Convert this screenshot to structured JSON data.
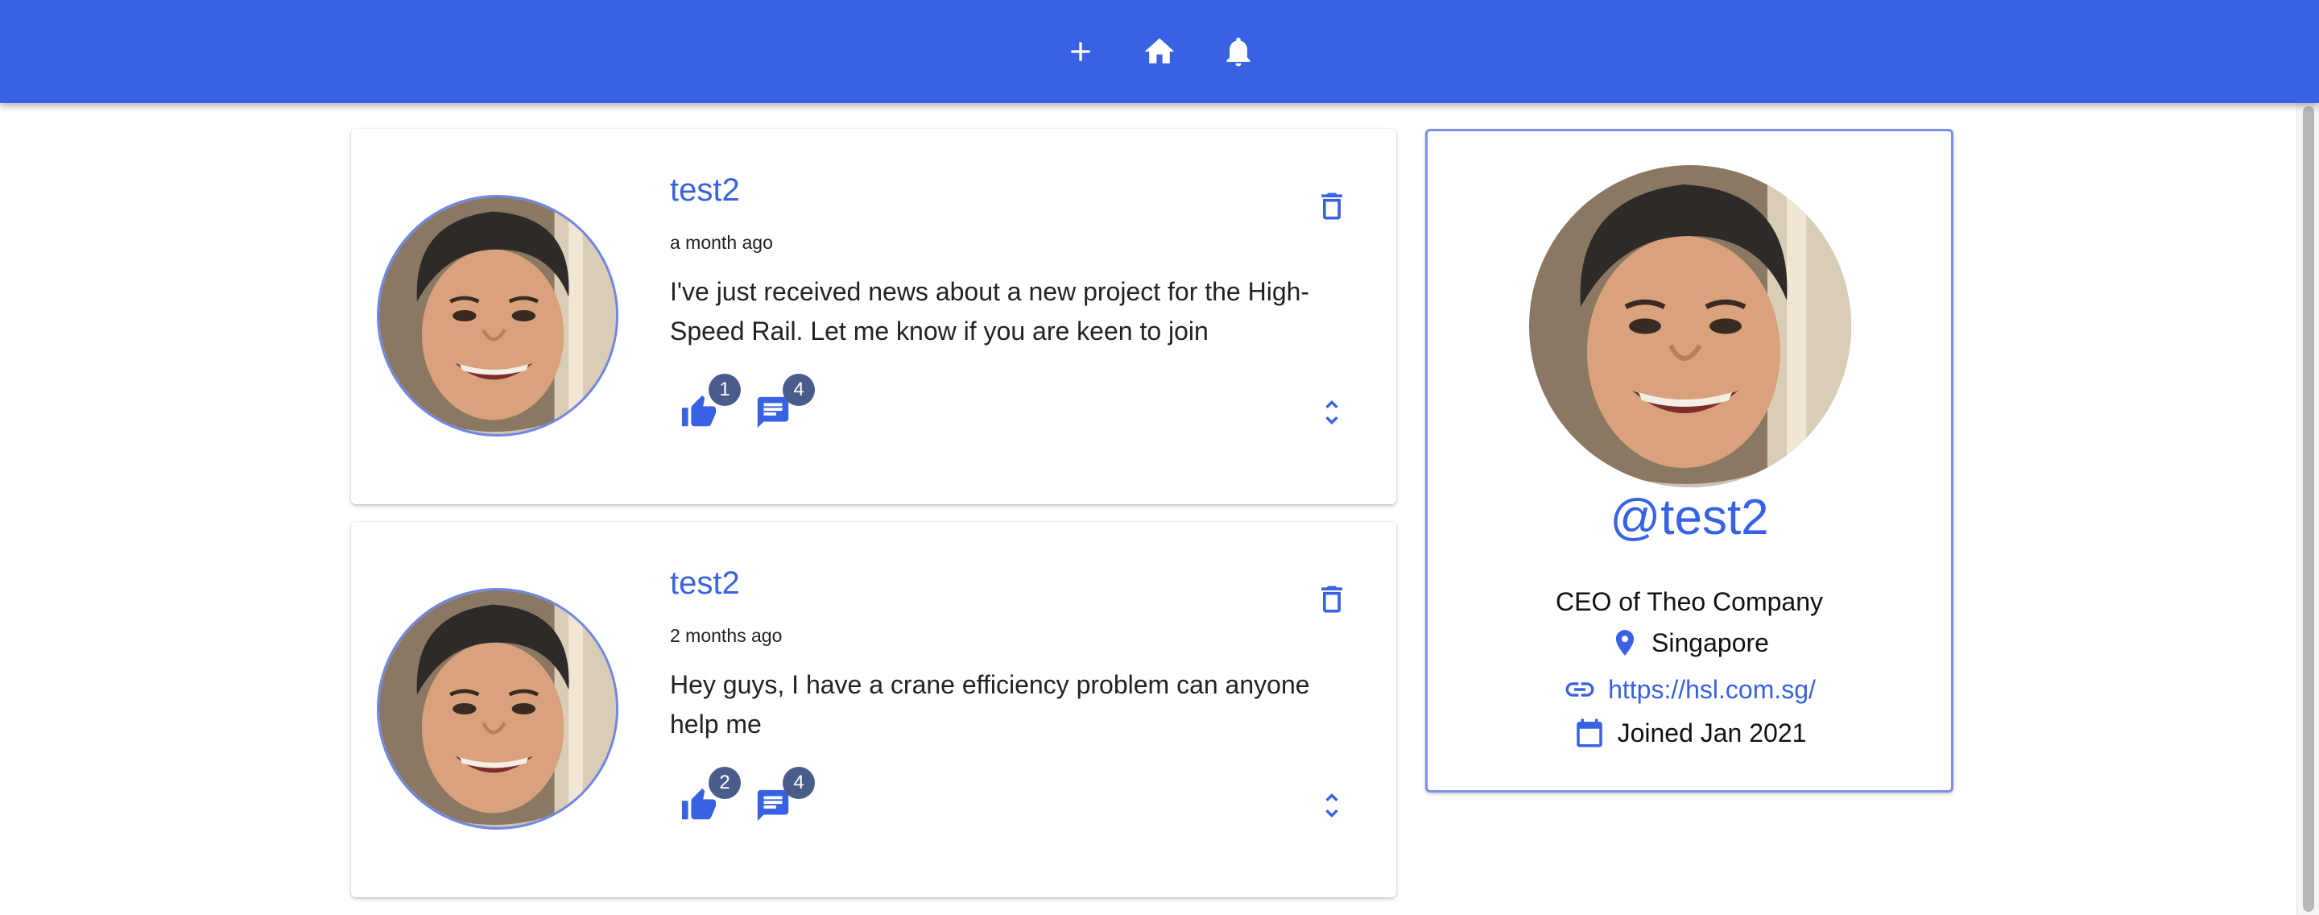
{
  "navbar": {
    "icons": [
      "add-icon",
      "home-icon",
      "notifications-icon"
    ],
    "color": "#3862e3"
  },
  "posts": [
    {
      "handle": "test2",
      "time": "a month ago",
      "body": "I've just received news about a new project for the High-Speed Rail. Let me know if you are keen to join",
      "likes": "1",
      "comments": "4"
    },
    {
      "handle": "test2",
      "time": "2 months ago",
      "body": "Hey guys, I have a crane efficiency problem can anyone help me",
      "likes": "2",
      "comments": "4"
    }
  ],
  "profile": {
    "handle": "@test2",
    "bio": "CEO of Theo Company",
    "location": "Singapore",
    "website": "https://hsl.com.sg/",
    "joined": "Joined Jan 2021"
  },
  "colors": {
    "accent": "#3862e3",
    "badge": "#4a5d8a"
  }
}
